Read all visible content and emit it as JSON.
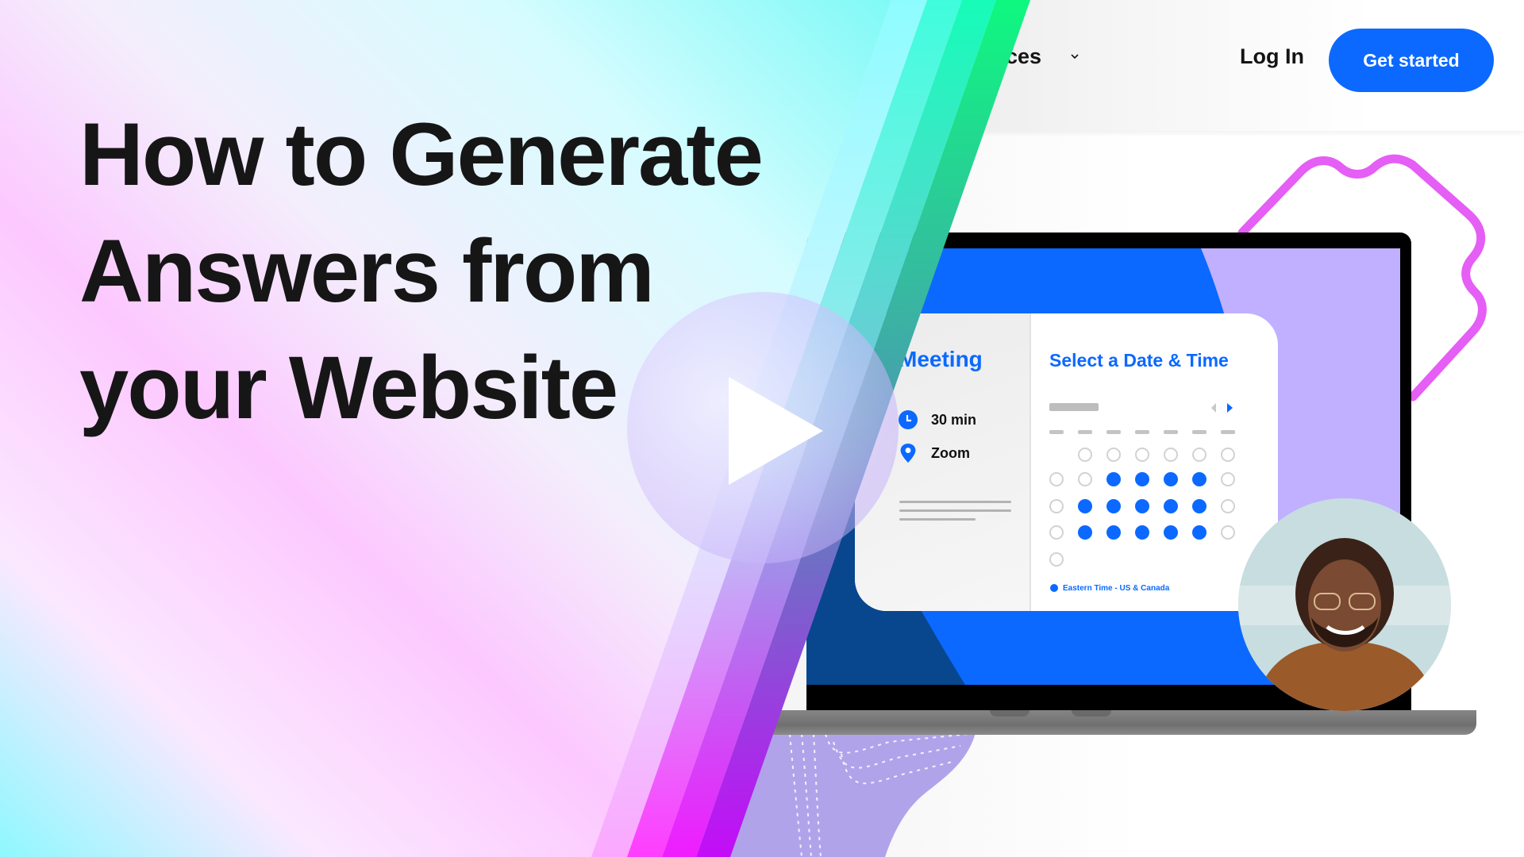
{
  "headline": {
    "line1": "How to Generate",
    "line2": "Answers from",
    "line3": "your Website"
  },
  "video": {
    "play_icon": "play-icon"
  },
  "nav": {
    "resources_label": "Resources",
    "resources_visible": "urces",
    "login_label": "Log In",
    "cta_label": "Get started"
  },
  "scheduler": {
    "event_title": "Meeting",
    "duration": "30 min",
    "location": "Zoom",
    "picker_title": "Select a Date & Time",
    "timezone": "Eastern Time - US & Canada",
    "icons": [
      "clock-icon",
      "location-pin-icon",
      "globe-icon",
      "chevron-left-icon",
      "chevron-right-icon"
    ],
    "calendar_rows": [
      [
        "empty",
        "off",
        "off",
        "off",
        "off",
        "off",
        "off"
      ],
      [
        "off",
        "off",
        "on",
        "on",
        "on",
        "on",
        "off"
      ],
      [
        "off",
        "on",
        "on",
        "on",
        "on",
        "on",
        "off"
      ],
      [
        "off",
        "on",
        "on",
        "on",
        "on",
        "on",
        "off"
      ],
      [
        "off",
        "empty",
        "empty",
        "empty",
        "empty",
        "empty",
        "empty"
      ]
    ]
  },
  "colors": {
    "brand_blue": "#0b69ff",
    "lavender": "#c0b0ff",
    "squiggle_pink": "#e55ef5",
    "headline_text": "#161616"
  }
}
